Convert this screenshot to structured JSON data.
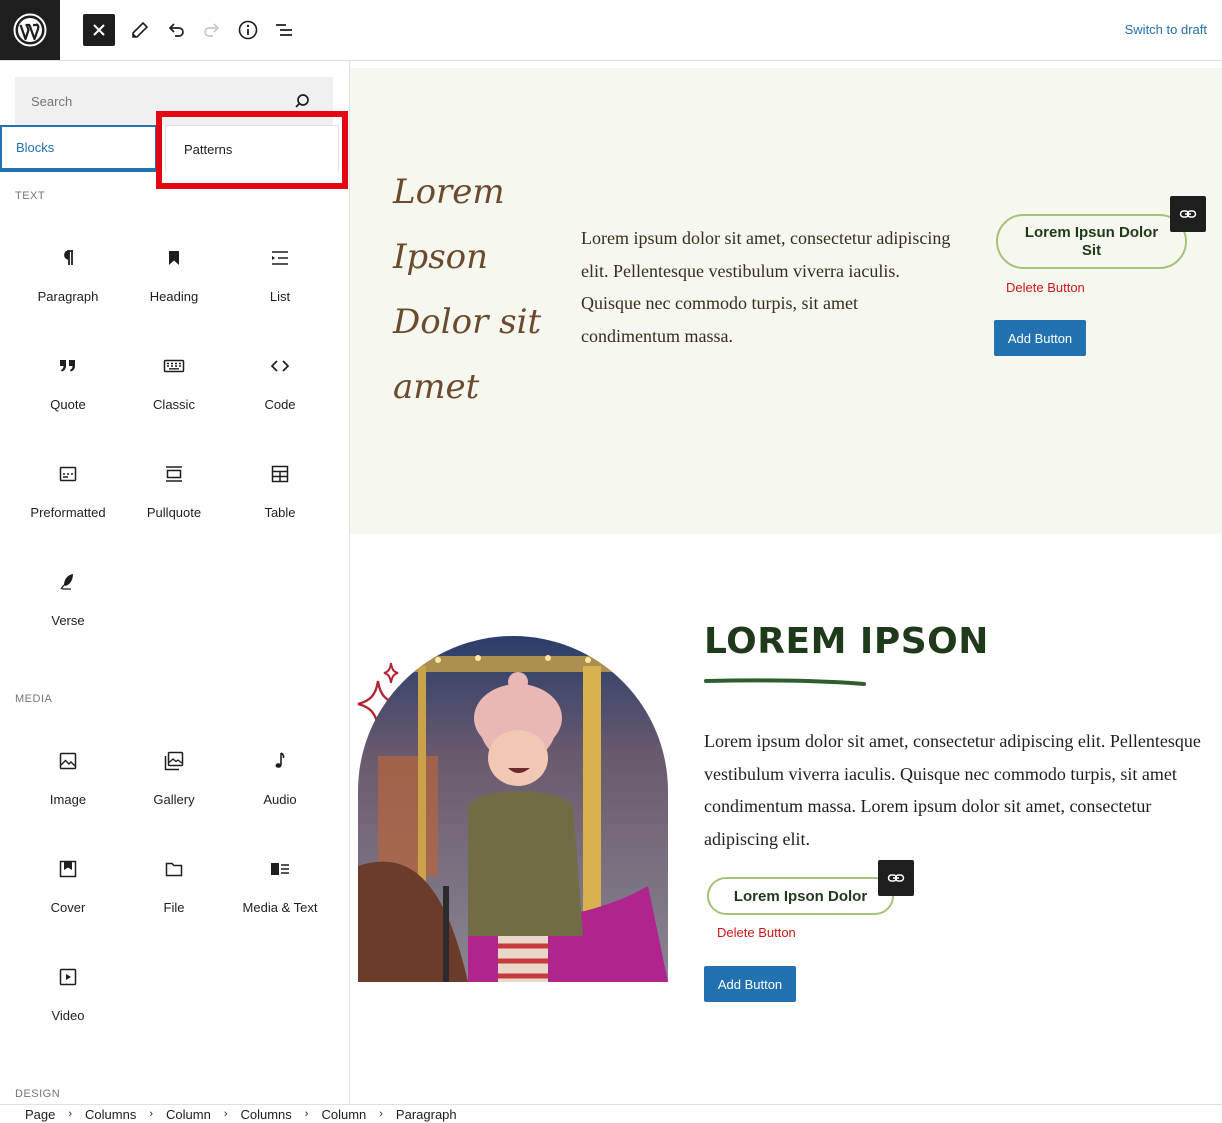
{
  "toolbar": {
    "switch_to_draft": "Switch to draft"
  },
  "inserter": {
    "search_placeholder": "Search",
    "tabs": [
      "Blocks",
      "Patterns"
    ],
    "categories": {
      "text": "TEXT",
      "media": "MEDIA",
      "design": "DESIGN"
    },
    "text_blocks": [
      "Paragraph",
      "Heading",
      "List",
      "Quote",
      "Classic",
      "Code",
      "Preformatted",
      "Pullquote",
      "Table",
      "Verse"
    ],
    "media_blocks": [
      "Image",
      "Gallery",
      "Audio",
      "Cover",
      "File",
      "Media & Text",
      "Video"
    ]
  },
  "canvas": {
    "section1": {
      "title": "Lorem Ipson Dolor sit amet",
      "body": "Lorem ipsum dolor sit amet, consectetur adipiscing elit. Pellentesque vestibulum viverra iaculis. Quisque nec commodo turpis, sit amet condimentum massa.",
      "pill_button": "Lorem Ipsun Dolor Sit",
      "delete_button": "Delete Button",
      "add_button": "Add Button"
    },
    "section2": {
      "heading": "LOREM IPSON",
      "body": "Lorem ipsum dolor sit amet, consectetur adipiscing elit. Pellentesque vestibulum viverra iaculis. Quisque nec commodo turpis, sit amet condimentum massa. Lorem ipsum dolor sit amet, consectetur adipiscing elit.",
      "pill_button": "Lorem Ipson Dolor",
      "delete_button": "Delete Button",
      "add_button": "Add Button"
    }
  },
  "breadcrumb": [
    "Page",
    "Columns",
    "Column",
    "Columns",
    "Column",
    "Paragraph"
  ],
  "colors": {
    "accent": "#2271b1",
    "delete": "#cc1818",
    "section_bg": "#f6f8ef",
    "title_brown": "#6b4a2f",
    "heading_green": "#1f3a1a",
    "highlight": "#e30613"
  }
}
